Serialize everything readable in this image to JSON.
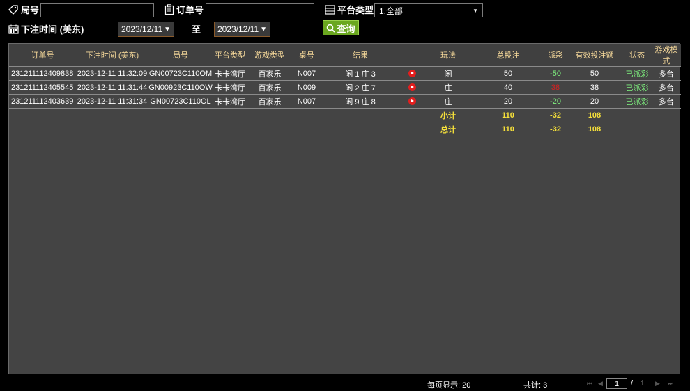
{
  "filters": {
    "round_label": "局号",
    "round_value": "",
    "order_label": "订单号",
    "order_value": "",
    "platform_label": "平台类型",
    "platform_selected": "1.全部",
    "time_label": "下注时间 (美东)",
    "date_from": "2023/12/11",
    "to_label": "至",
    "date_to": "2023/12/11",
    "query_label": "查询"
  },
  "table": {
    "headers": [
      "订单号",
      "下注时间 (美东)",
      "局号",
      "平台类型",
      "游戏类型",
      "桌号",
      "结果",
      "",
      "玩法",
      "总投注",
      "派彩",
      "有效投注额",
      "状态",
      "游戏模式"
    ],
    "rows": [
      {
        "order": "231211112409838",
        "time": "2023-12-11 11:32:09",
        "round": "GN00723C110OM",
        "platform": "卡卡湾厅",
        "game": "百家乐",
        "table_no": "N007",
        "result": "闲 1 庄 3",
        "play": "闲",
        "bet": "50",
        "payout": "-50",
        "valid": "50",
        "status": "已派彩",
        "mode": "多台"
      },
      {
        "order": "231211112405545",
        "time": "2023-12-11 11:31:44",
        "round": "GN00923C110OW",
        "platform": "卡卡湾厅",
        "game": "百家乐",
        "table_no": "N009",
        "result": "闲 2 庄 7",
        "play": "庄",
        "bet": "40",
        "payout": "38",
        "valid": "38",
        "status": "已派彩",
        "mode": "多台"
      },
      {
        "order": "231211112403639",
        "time": "2023-12-11 11:31:34",
        "round": "GN00723C110OL",
        "platform": "卡卡湾厅",
        "game": "百家乐",
        "table_no": "N007",
        "result": "闲 9 庄 8",
        "play": "庄",
        "bet": "20",
        "payout": "-20",
        "valid": "20",
        "status": "已派彩",
        "mode": "多台"
      }
    ],
    "subtotal": {
      "label": "小计",
      "bet": "110",
      "payout": "-32",
      "valid": "108"
    },
    "total": {
      "label": "总计",
      "bet": "110",
      "payout": "-32",
      "valid": "108"
    }
  },
  "footer": {
    "per_page": "每页显示: 20",
    "count": "共计: 3",
    "current_page": "1",
    "separator": "/",
    "total_pages": "1"
  },
  "colors": {
    "positive": "#7ef07e",
    "negative": "#d62020",
    "summary": "#f7e13a",
    "header_text": "#f5d89a",
    "query_button": "#6aa71f"
  }
}
